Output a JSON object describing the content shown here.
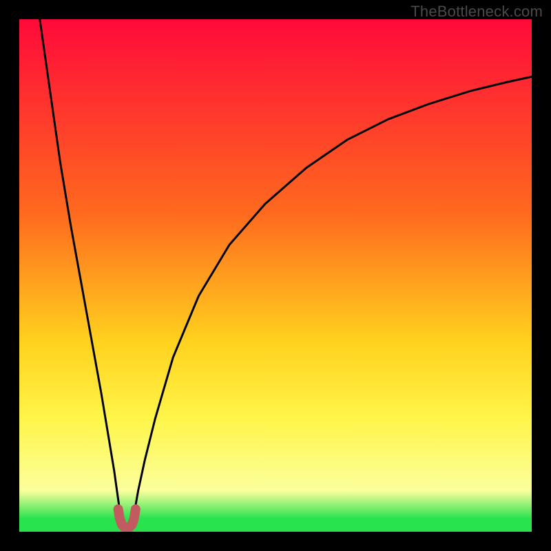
{
  "watermark": "TheBottleneck.com",
  "colors": {
    "frame": "#000000",
    "grad_top": "#ff0a3a",
    "grad_upper_mid": "#ff6a1e",
    "grad_mid": "#ffd21e",
    "grad_lower_mid": "#fff54a",
    "grad_low": "#fbff9c",
    "grad_green": "#28e24e",
    "curve": "#000000",
    "marker_fill": "#c25b5f",
    "marker_stroke": "#c25b5f"
  },
  "chart_data": {
    "type": "line",
    "title": "",
    "xlabel": "",
    "ylabel": "",
    "xlim": [
      0,
      100
    ],
    "ylim": [
      0,
      100
    ],
    "series": [
      {
        "name": "left-branch",
        "x": [
          4,
          6,
          8,
          10,
          12,
          14,
          16,
          17.5,
          18.5,
          19.2,
          19.7,
          20.0
        ],
        "values": [
          100,
          86,
          72,
          60,
          49,
          38,
          27,
          18,
          12,
          7,
          3.5,
          1.2
        ]
      },
      {
        "name": "right-branch",
        "x": [
          22.0,
          22.4,
          23.2,
          24.5,
          26.5,
          30,
          35,
          41,
          48,
          56,
          64,
          72,
          80,
          88,
          95,
          100
        ],
        "values": [
          1.2,
          3.5,
          8,
          14,
          22,
          34,
          46,
          56,
          64,
          71,
          76.5,
          80.5,
          83.5,
          86,
          87.7,
          88.8
        ]
      },
      {
        "name": "min-marker-u",
        "x": [
          19.3,
          19.6,
          20.0,
          20.5,
          21.0,
          21.5,
          22.0,
          22.4,
          22.7
        ],
        "values": [
          4.4,
          2.6,
          1.4,
          0.9,
          0.8,
          0.9,
          1.4,
          2.6,
          4.4
        ]
      }
    ],
    "gradient_stops": [
      {
        "offset": 0,
        "key": "grad_top"
      },
      {
        "offset": 38,
        "key": "grad_upper_mid"
      },
      {
        "offset": 63,
        "key": "grad_mid"
      },
      {
        "offset": 78,
        "key": "grad_lower_mid"
      },
      {
        "offset": 92,
        "key": "grad_low"
      },
      {
        "offset": 97.5,
        "key": "grad_green"
      },
      {
        "offset": 100,
        "key": "grad_green"
      }
    ]
  }
}
